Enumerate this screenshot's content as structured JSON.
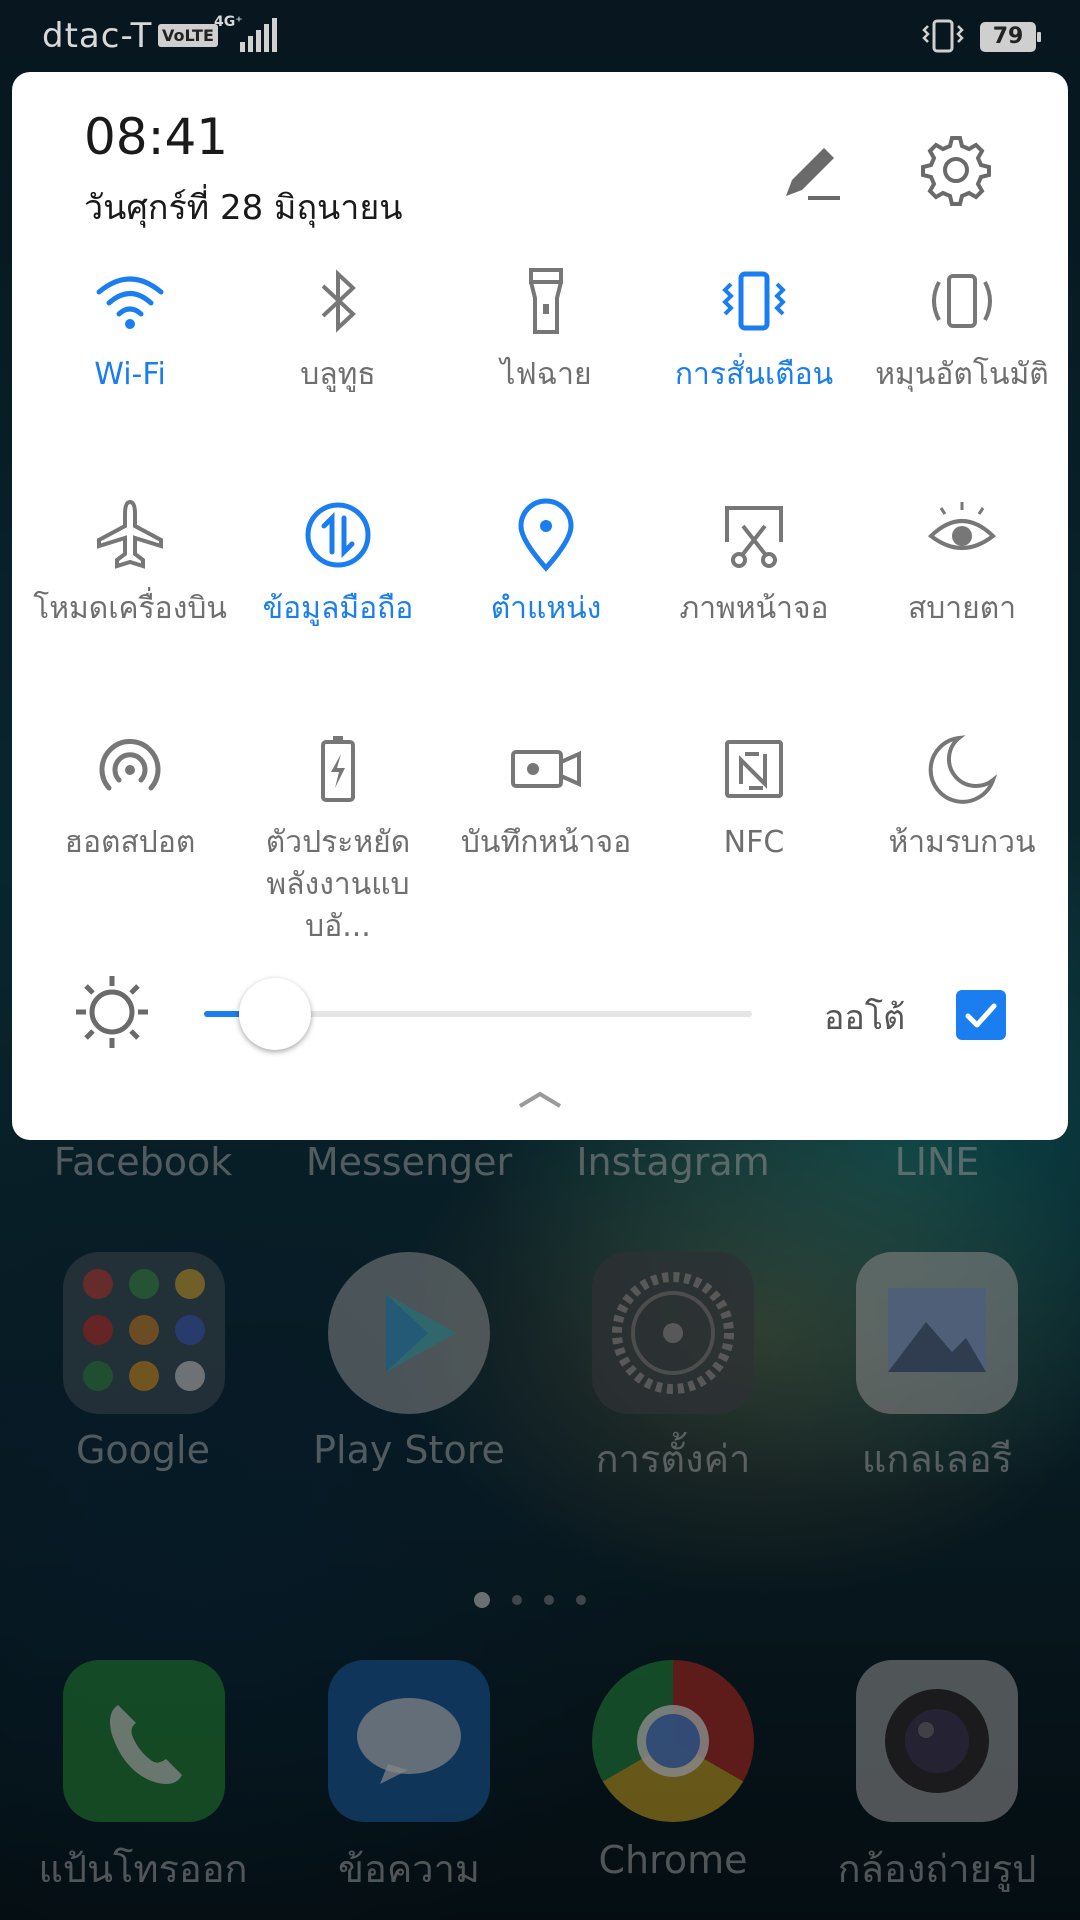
{
  "status_bar": {
    "carrier": "dtac-T",
    "volte": "VoLTE",
    "network": "4G⁺",
    "battery": "79"
  },
  "panel": {
    "time": "08:41",
    "date": "วันศุกร์ที่ 28 มิถุนายน",
    "edit_icon": "edit-pencil-icon",
    "settings_icon": "gear-icon"
  },
  "tiles": [
    {
      "label": "Wi-Fi",
      "icon": "wifi-icon",
      "active": true
    },
    {
      "label": "บลูทูธ",
      "icon": "bluetooth-icon",
      "active": false
    },
    {
      "label": "ไฟฉาย",
      "icon": "flashlight-icon",
      "active": false
    },
    {
      "label": "การสั่นเตือน",
      "icon": "vibrate-icon",
      "active": true
    },
    {
      "label": "หมุนอัตโนมัติ",
      "icon": "auto-rotate-icon",
      "active": false
    },
    {
      "label": "โหมดเครื่องบิน",
      "icon": "airplane-icon",
      "active": false
    },
    {
      "label": "ข้อมูลมือถือ",
      "icon": "mobile-data-icon",
      "active": true
    },
    {
      "label": "ตำแหน่ง",
      "icon": "location-icon",
      "active": true
    },
    {
      "label": "ภาพหน้าจอ",
      "icon": "screenshot-icon",
      "active": false
    },
    {
      "label": "สบายตา",
      "icon": "eye-comfort-icon",
      "active": false
    },
    {
      "label": "ฮอตสปอต",
      "icon": "hotspot-icon",
      "active": false
    },
    {
      "label": "ตัวประหยัดพลังงานแบบอั...",
      "icon": "battery-saver-icon",
      "active": false
    },
    {
      "label": "บันทึกหน้าจอ",
      "icon": "screen-record-icon",
      "active": false
    },
    {
      "label": "NFC",
      "icon": "nfc-icon",
      "active": false
    },
    {
      "label": "ห้ามรบกวน",
      "icon": "moon-icon",
      "active": false
    }
  ],
  "brightness": {
    "level": 0.13,
    "auto_label": "ออโต้",
    "auto_checked": true
  },
  "home": {
    "top_row": [
      "Facebook",
      "Messenger",
      "Instagram",
      "LINE"
    ],
    "apps": [
      "Google",
      "Play Store",
      "การตั้งค่า",
      "แกลเลอรี"
    ],
    "dock": [
      "แป้นโทรออก",
      "ข้อความ",
      "Chrome",
      "กล้องถ่ายรูป"
    ],
    "pages": 4,
    "current_page": 1
  },
  "colors": {
    "accent": "#1b7ef0",
    "inactive": "#6f6f6f"
  }
}
